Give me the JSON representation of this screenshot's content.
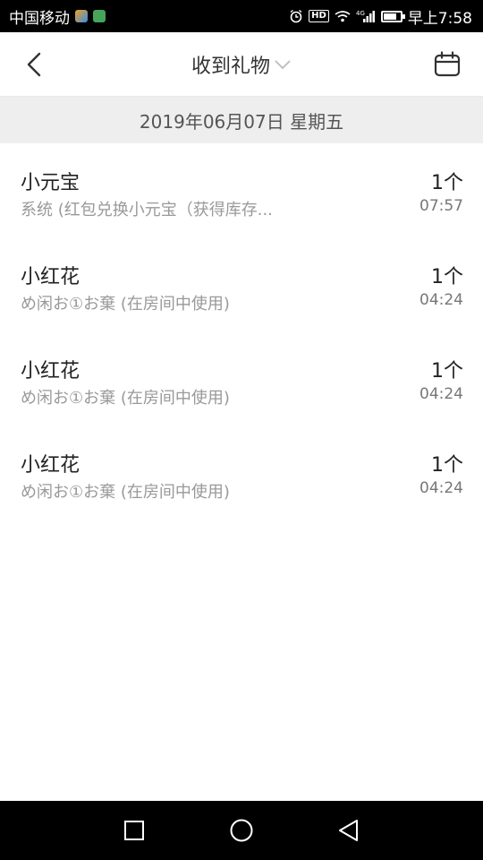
{
  "status_bar": {
    "carrier": "中国移动",
    "time": "早上7:58",
    "hd_label": "HD",
    "network_label": "4G",
    "icons": [
      "alarm-icon",
      "hd-icon",
      "wifi-icon",
      "signal-icon",
      "battery-icon"
    ]
  },
  "header": {
    "title": "收到礼物",
    "back_icon": "chevron-left-icon",
    "dropdown_icon": "chevron-down-icon",
    "calendar_icon": "calendar-icon"
  },
  "date_bar": {
    "label": "2019年06月07日 星期五"
  },
  "gifts": [
    {
      "name": "小元宝",
      "desc": "系统 (红包兑换小元宝（获得库存...",
      "count": "1个",
      "time": "07:57"
    },
    {
      "name": "小红花",
      "desc": "め闲お①お棄 (在房间中使用)",
      "count": "1个",
      "time": "04:24"
    },
    {
      "name": "小红花",
      "desc": "め闲お①お棄 (在房间中使用)",
      "count": "1个",
      "time": "04:24"
    },
    {
      "name": "小红花",
      "desc": "め闲お①お棄 (在房间中使用)",
      "count": "1个",
      "time": "04:24"
    }
  ],
  "nav_bar": {
    "icons": [
      "square-icon",
      "circle-icon",
      "triangle-back-icon"
    ]
  },
  "colors": {
    "status_bar_bg": "#000000",
    "date_bar_bg": "#eeeeee",
    "primary_text": "#222222",
    "secondary_text": "#999999"
  }
}
